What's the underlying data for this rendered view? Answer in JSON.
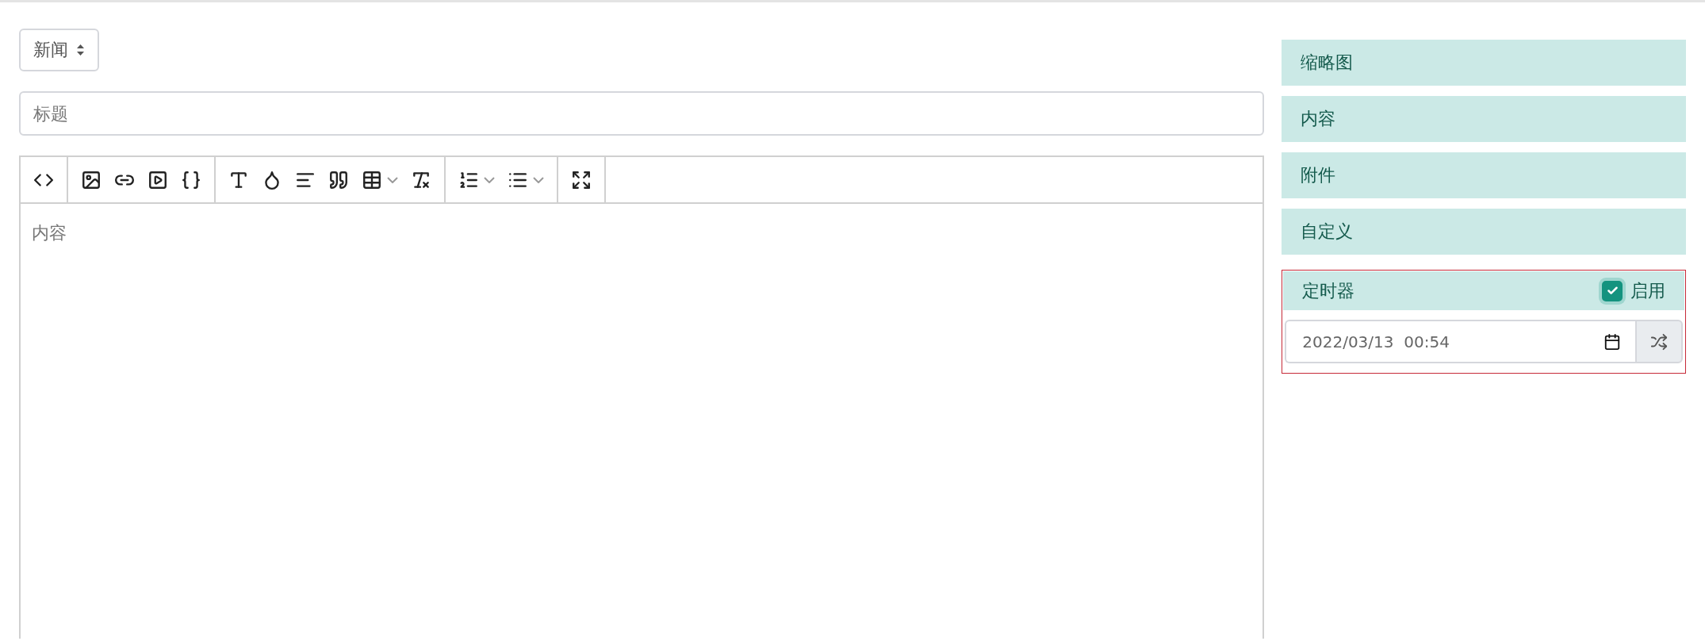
{
  "category_select": {
    "value": "新闻"
  },
  "title_field": {
    "placeholder": "标题"
  },
  "editor": {
    "toolbar": [
      {
        "buttons": [
          {
            "kind": "code",
            "has_menu": false
          }
        ]
      },
      {
        "buttons": [
          {
            "kind": "image",
            "has_menu": false
          },
          {
            "kind": "link",
            "has_menu": false
          },
          {
            "kind": "video",
            "has_menu": false
          },
          {
            "kind": "snippet",
            "has_menu": false
          }
        ]
      },
      {
        "buttons": [
          {
            "kind": "text",
            "has_menu": false
          },
          {
            "kind": "color",
            "has_menu": false
          },
          {
            "kind": "align",
            "has_menu": false
          },
          {
            "kind": "quote",
            "has_menu": false
          },
          {
            "kind": "table",
            "has_menu": true
          },
          {
            "kind": "clear",
            "has_menu": false
          }
        ]
      },
      {
        "buttons": [
          {
            "kind": "ordered",
            "has_menu": true
          },
          {
            "kind": "bullets",
            "has_menu": true
          }
        ]
      },
      {
        "buttons": [
          {
            "kind": "fullscreen",
            "has_menu": false
          }
        ]
      }
    ],
    "placeholder": "内容"
  },
  "sidebar": {
    "panels": [
      {
        "title": "缩略图"
      },
      {
        "title": "内容"
      },
      {
        "title": "附件"
      },
      {
        "title": "自定义"
      }
    ],
    "timer": {
      "title": "定时器",
      "enable_label": "启用",
      "checked": true,
      "value": "2022/03/13  00:54"
    }
  }
}
